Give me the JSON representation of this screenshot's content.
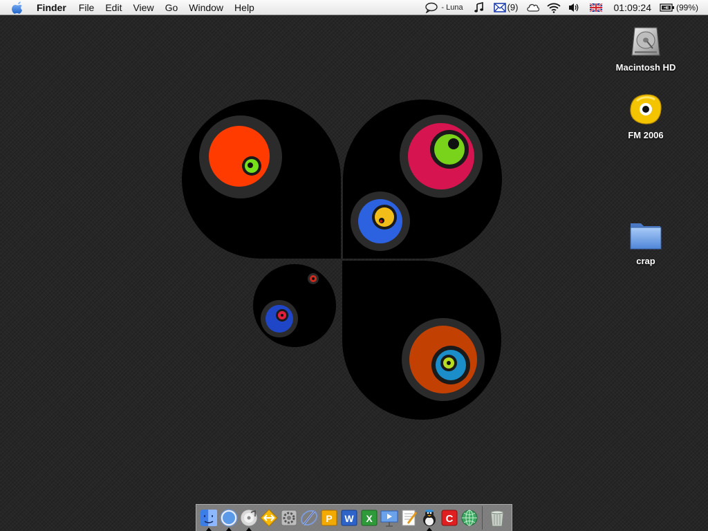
{
  "menubar": {
    "app_name": "Finder",
    "menus": [
      "File",
      "Edit",
      "View",
      "Go",
      "Window",
      "Help"
    ],
    "status": {
      "chat_name": "- Luna",
      "mail_count": "(9)",
      "clock": "01:09:24",
      "battery": "(99%)"
    }
  },
  "desktop": {
    "icons": [
      {
        "label": "Macintosh HD",
        "icon": "hard-drive-icon"
      },
      {
        "label": "FM 2006",
        "icon": "fm-disk-icon"
      },
      {
        "label": "crap",
        "icon": "folder-icon"
      }
    ]
  },
  "dock": {
    "apps": [
      {
        "name": "finder",
        "icon": "finder-icon",
        "running": true
      },
      {
        "name": "safari",
        "icon": "safari-icon",
        "running": true
      },
      {
        "name": "itunes",
        "icon": "itunes-icon",
        "running": true
      },
      {
        "name": "transmit",
        "icon": "transmit-icon",
        "running": false
      },
      {
        "name": "system-preferences",
        "icon": "system-preferences-icon",
        "running": false
      },
      {
        "name": "xcode",
        "icon": "xcode-icon",
        "running": false
      },
      {
        "name": "powerpoint",
        "icon": "powerpoint-icon",
        "running": false
      },
      {
        "name": "word",
        "icon": "word-icon",
        "running": false
      },
      {
        "name": "excel",
        "icon": "excel-icon",
        "running": false
      },
      {
        "name": "keynote",
        "icon": "keynote-icon",
        "running": false
      },
      {
        "name": "textedit",
        "icon": "textedit-icon",
        "running": false
      },
      {
        "name": "adium",
        "icon": "adium-icon",
        "running": true
      },
      {
        "name": "app-c",
        "icon": "app-c-icon",
        "running": false
      },
      {
        "name": "network-app",
        "icon": "globe-icon",
        "running": false
      }
    ],
    "trash": {
      "icon": "trash-icon"
    }
  },
  "colors": {
    "desktop_bg": "#262626",
    "fm_yellow": "#f5c400",
    "folder_blue": "#6ea0e6"
  }
}
